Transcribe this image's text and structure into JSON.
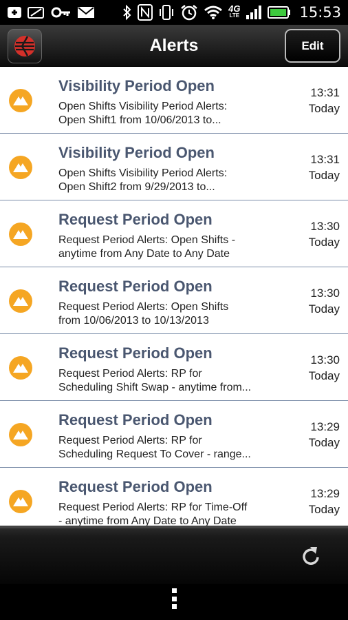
{
  "status_bar": {
    "time": "15:53",
    "network_label": "4G",
    "network_sub": "LTE",
    "icons": [
      "add-icon",
      "wallet-icon",
      "key-icon",
      "mail-icon",
      "bluetooth-icon",
      "nfc-icon",
      "vibrate-icon",
      "alarm-icon",
      "wifi-icon",
      "signal-icon",
      "battery-icon"
    ]
  },
  "action_bar": {
    "title": "Alerts",
    "edit_label": "Edit"
  },
  "alerts": [
    {
      "title": "Visibility Period Open",
      "line1": "Open Shifts Visibility Period Alerts:",
      "line2": "Open Shift1 from 10/06/2013 to...",
      "time": "13:31",
      "day": "Today"
    },
    {
      "title": "Visibility Period Open",
      "line1": "Open Shifts Visibility Period Alerts:",
      "line2": "Open Shift2 from 9/29/2013 to...",
      "time": "13:31",
      "day": "Today"
    },
    {
      "title": "Request Period Open",
      "line1": "Request Period Alerts: Open Shifts -",
      "line2": "anytime from Any Date to Any Date",
      "time": "13:30",
      "day": "Today"
    },
    {
      "title": "Request Period Open",
      "line1": "Request Period Alerts: Open Shifts",
      "line2": "from 10/06/2013 to 10/13/2013",
      "time": "13:30",
      "day": "Today"
    },
    {
      "title": "Request Period Open",
      "line1": "Request Period Alerts: RP for",
      "line2": "Scheduling Shift Swap - anytime from...",
      "time": "13:30",
      "day": "Today"
    },
    {
      "title": "Request Period Open",
      "line1": "Request Period Alerts: RP for",
      "line2": "Scheduling Request To Cover - range...",
      "time": "13:29",
      "day": "Today"
    },
    {
      "title": "Request Period Open",
      "line1": "Request Period Alerts: RP for Time-Off",
      "line2": "- anytime from Any Date to Any Date",
      "time": "13:29",
      "day": "Today"
    }
  ],
  "colors": {
    "alert_icon": "#f5a623",
    "title_text": "#4a5770",
    "divider": "#7a8ca8"
  },
  "toolbar": {
    "refresh_icon": "refresh-icon"
  },
  "nav": {
    "menu_icon": "overflow-menu-icon"
  }
}
